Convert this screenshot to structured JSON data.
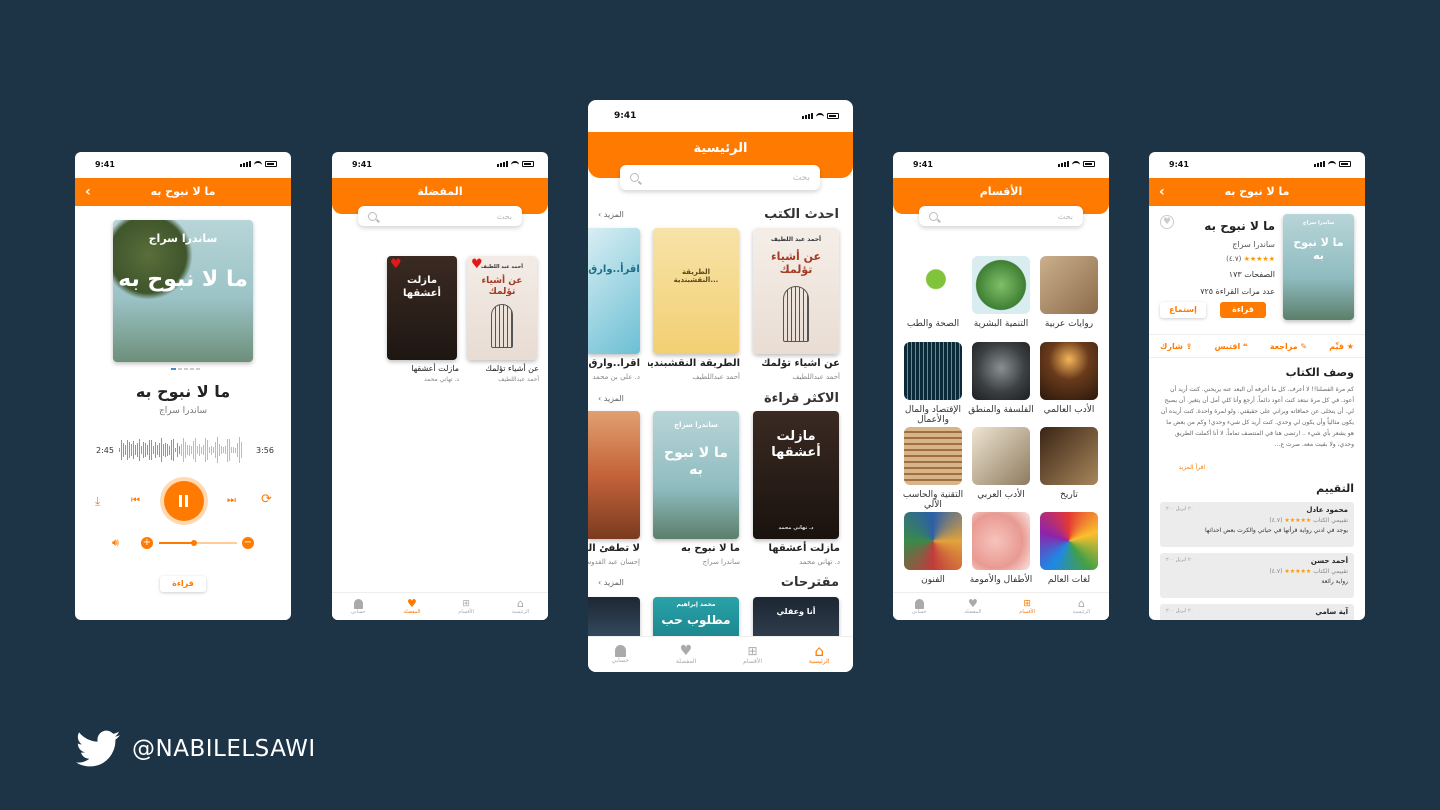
{
  "status_time": "9:41",
  "handle": "@NABILELSAWI",
  "colors": {
    "accent": "#ff7a00",
    "background": "#1d3346"
  },
  "nav": {
    "home": "الرئيسية",
    "sections": "الأقسام",
    "favorites": "المفضلة",
    "account": "حسابي"
  },
  "search_placeholder": "بحث",
  "books": {
    "ma_la_nabouh": {
      "title": "ما لا نبوح به",
      "author": "ساندرا سراج",
      "cover_author": "ساندرا سراج"
    },
    "mazelt": {
      "title": "مازلت أعشقها",
      "author": "د. تهاني محمد",
      "cover_sub": "د. تهاني محمد"
    },
    "ashyaa": {
      "title": "عن أشياء تؤلمك",
      "author": "أحمد عبداللطيف",
      "cover_author": "أحمد عبد اللطيف"
    },
    "tariqa": {
      "title": "الطريقة النقشبندية...",
      "author": "أحمد عبداللطيف"
    },
    "iqra": {
      "title": "اقرأ..وارق",
      "author": "د. علي بن محمد"
    },
    "la_tutfi": {
      "title": "لا تطفئ الشمس",
      "author": "إحسان عبد القدوس"
    },
    "matloob": {
      "cover_author": "محمد إبراهيم",
      "cover_title": "مطلوب حب"
    },
    "ana_wa_aqli": {
      "cover_title": "أنا وعقلي"
    }
  },
  "player": {
    "header": "ما لا نبوح به",
    "title": "ما لا نبوح به",
    "author": "ساندرا سراج",
    "time_elapsed": "2:45",
    "time_total": "3:56",
    "read_button": "قراءة",
    "progress": 0.5,
    "volume": 0.45
  },
  "favorites_screen": {
    "header": "المفضلة"
  },
  "home_screen": {
    "header": "الرئيسية",
    "section_latest": "احدث الكتب",
    "section_most_read": "الاكثر قراءة",
    "section_suggested": "مقترحات",
    "more": "المزيد"
  },
  "categories_screen": {
    "header": "الأقسام",
    "items": [
      {
        "label": "روايات عربية",
        "icon": "manuscript-photo"
      },
      {
        "label": "التنمية البشرية",
        "icon": "tree-photo"
      },
      {
        "label": "الصحة والطب",
        "icon": "apple-stethoscope-photo"
      },
      {
        "label": "الأدب العالمي",
        "icon": "candle-books-photo"
      },
      {
        "label": "الفلسفة والمنطق",
        "icon": "thinker-statue-photo"
      },
      {
        "label": "الإقتصاد والمال والأعمال",
        "icon": "stock-chart-photo"
      },
      {
        "label": "تاريخ",
        "icon": "quill-photo"
      },
      {
        "label": "الأدب العربي",
        "icon": "scholar-photo"
      },
      {
        "label": "التقنية والحاسب الآلي",
        "icon": "books-stack-photo"
      },
      {
        "label": "لغات العالم",
        "icon": "flags-photo"
      },
      {
        "label": "الأطفال والأمومة",
        "icon": "baby-feet-photo"
      },
      {
        "label": "الفنون",
        "icon": "art-photo"
      }
    ]
  },
  "detail_screen": {
    "header": "ما لا نبوح به",
    "title": "ما لا نبوح به",
    "author": "ساندرا سراج",
    "rating": "(٤.٧)",
    "pages": "الصفحات ١٧٣",
    "reads": "عدد مرات القراءة ٧٢٥",
    "read_button": "قراءة",
    "listen_button": "إستماع",
    "actions": {
      "rate": "قيِّم",
      "review": "مراجعة",
      "quote": "اقتبس",
      "share": "شارك"
    },
    "desc_title": "وصف الكتاب",
    "description": "كم مرة الفصلنا!! لا أعرف. كل ما أعرفه أن البعد عنه يريحني. كنت أريد أن أعود. في كل مرة نبتعد كنت أعود دائماً. أرجع وأنا كلي أمل أن يتغير. أن يصبح لي. أن يتخلى عن حماقاته ويراني على حقيقتي. ولو لمرة واحدة. كنت أريده أن يكون مثالياً وأن يكون لي وحدي. كنت أريد كل شيء وحدي! وكم من بعض ما هو يشعر بأي شيء .. ارتضى هنا في المنتصف تماماً. لا أنا أكملت الطريق وحدي، ولا بقيت معه. صرت ع...",
    "read_more": "اقرأ المزيد",
    "ratings_title": "التقييم",
    "reviews": [
      {
        "name": "محمود عادل",
        "date": "٢٠ ابريل ٢٠٠",
        "role": "تقييمي الكتاب",
        "rating": "(٤.٧)",
        "text": "يوجد في ادني رواية قرأتها في حياتي والكرت بعض احداثها"
      },
      {
        "name": "أحمد حسن",
        "date": "٢٠ ابريل ٢٠٠",
        "role": "تقييمي الكتاب",
        "rating": "(٤.٧)",
        "text": "رواية رائعة"
      },
      {
        "name": "آية سامي",
        "date": "٢٠ ابريل ٢٠٠",
        "role": "",
        "rating": "",
        "text": ""
      }
    ]
  }
}
